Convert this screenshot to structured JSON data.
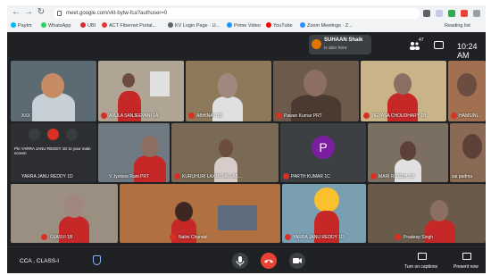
{
  "browser": {
    "url": "meet.google.com/vkt-bytw-fca?authuser=0",
    "bookmarks": [
      "Paytm",
      "WhatsApp",
      "UBI",
      "ACT Fibernet Portal...",
      "KV Login Page · U...",
      "Prime Video",
      "YouTube",
      "Zoom Meetings · Z...",
      "Reading list"
    ]
  },
  "meet": {
    "notification": {
      "name": "SUHAAN Shaik",
      "sub": "is also here"
    },
    "people_count": "47",
    "time": "10:24 AM"
  },
  "tiles": [
    {
      "name": "XXX",
      "bg": "#5c6b73"
    },
    {
      "name": "AVULA SANJEEVANI 1A",
      "bg": "#b0a595"
    },
    {
      "name": "ABHINAV 1B",
      "bg": "#8d7a5a"
    },
    {
      "name": "Pawan Kumar PRT",
      "bg": "#6d5a4a"
    },
    {
      "name": "JIGYASA CHOUDHARY 1B",
      "bg": "#c9b48a"
    },
    {
      "name": "HAMSINI...",
      "bg": "#a07050"
    },
    {
      "name": "YARRA JANU REDDY 1D",
      "bg": "#2d2f33",
      "hover": true,
      "pin_caption": "Pin YARRA JANU REDDY 1D to your main screen"
    },
    {
      "name": "V Jyotsna Rani PRT",
      "bg": "#6f7a82"
    },
    {
      "name": "KURUHURI LAXMI VALLAB...",
      "bg": "#7a6a55"
    },
    {
      "name": "PARTH KUMAR 1C",
      "bg": "#3c4043",
      "avatar": "P"
    },
    {
      "name": "MARI RITESH 1D",
      "bg": "#7a6f60"
    },
    {
      "name": "sai padma",
      "bg": "#8a6a55"
    },
    {
      "name": "OJASVI 1B",
      "bg": "#9a8f80"
    },
    {
      "name": "Nalini Chandel",
      "bg": "#b07040"
    },
    {
      "name": "YARRA JANU REDDY 1D",
      "bg": "#7a9fb0"
    },
    {
      "name": "Pradeep Singh",
      "bg": "#6a5a4a"
    }
  ],
  "bottom": {
    "meeting_code": "CCA , CLASS-I",
    "captions_label": "Turn on captions",
    "present_label": "Present now"
  },
  "colors": {
    "meet_bg": "#202124",
    "mic_off": "#d93025",
    "end_call": "#ea4335"
  }
}
